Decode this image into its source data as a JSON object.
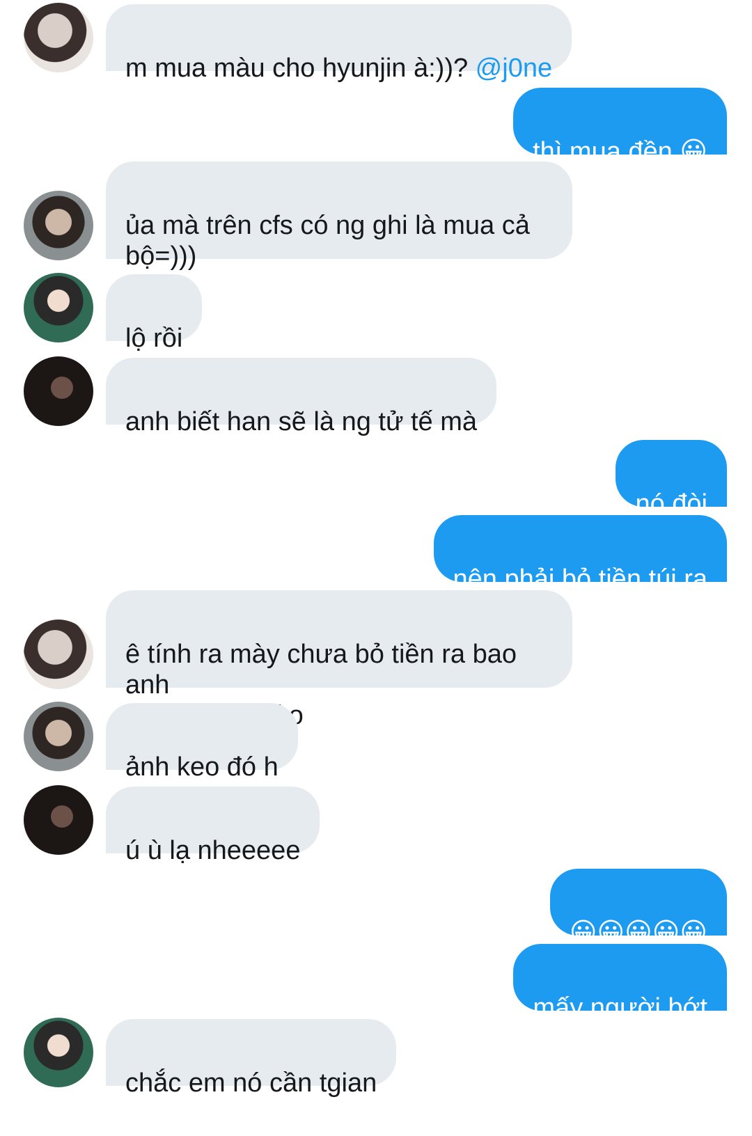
{
  "messages": [
    {
      "side": "in",
      "avatar": "avatar-1",
      "text": "m mua màu cho hyunjin à:))? ",
      "mention": "@j0ne"
    },
    {
      "side": "out",
      "text": "thì mua đền ",
      "emoji": "😀"
    },
    {
      "side": "in",
      "avatar": "avatar-2",
      "text": "ủa mà trên cfs có ng ghi là mua cả\nbộ=)))"
    },
    {
      "side": "in",
      "avatar": "avatar-3",
      "text": "lộ rồi"
    },
    {
      "side": "in",
      "avatar": "avatar-4",
      "text": "anh biết han sẽ là ng tử tế mà"
    },
    {
      "side": "out",
      "text": "nó đòi"
    },
    {
      "side": "out",
      "text": "nên phải bỏ tiền túi ra"
    },
    {
      "side": "in",
      "avatar": "avatar-1",
      "text": "ê tính ra mày chưa bỏ tiền ra bao anh\nem đc bữa nào"
    },
    {
      "side": "in",
      "avatar": "avatar-2",
      "text": "ảnh keo đó h"
    },
    {
      "side": "in",
      "avatar": "avatar-4",
      "text": "ú ù lạ nheeeee"
    },
    {
      "side": "out",
      "text": "",
      "emoji": "😀😀😀😀😀"
    },
    {
      "side": "out",
      "text": "mấy người bớt"
    },
    {
      "side": "in",
      "avatar": "avatar-3",
      "text": "chắc em nó cần tgian"
    }
  ],
  "colors": {
    "outgoing": "#1d9bf0",
    "incoming": "#e6ebef",
    "mention": "#1d9bf0"
  }
}
